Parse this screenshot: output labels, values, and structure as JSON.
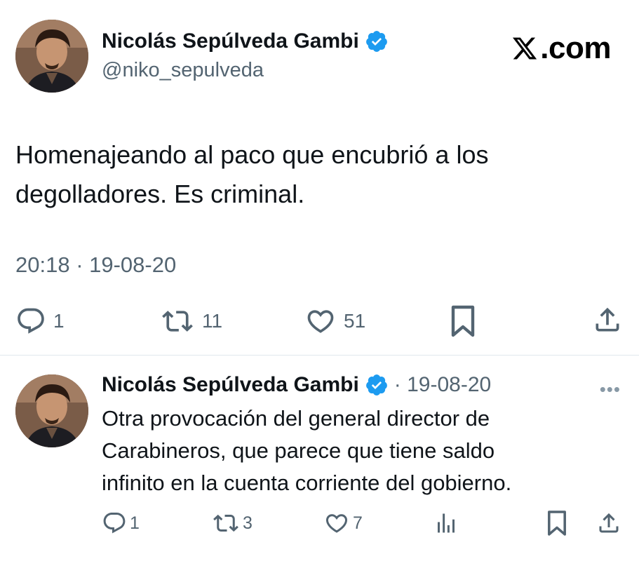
{
  "brand": {
    "text": ".com",
    "icon": "x-logo-icon"
  },
  "tweet": {
    "author_name": "Nicolás Sepúlveda Gambi",
    "handle": "@niko_sepulveda",
    "text_line1": "Homenajeando al paco que encubrió a los",
    "text_line2": "degolladores. Es criminal.",
    "timestamp": "20:18 · 19-08-20",
    "actions": {
      "reply_count": "1",
      "retweet_count": "11",
      "like_count": "51"
    }
  },
  "reply": {
    "author_name": "Nicolás Sepúlveda Gambi",
    "date": "· 19-08-20",
    "text_line1": "Otra provocación del general director de",
    "text_line2": "Carabineros, que parece que tiene saldo",
    "text_line3": "infinito en la cuenta corriente del gobierno.",
    "actions": {
      "reply_count": "1",
      "retweet_count": "3",
      "like_count": "7"
    },
    "more": "•••"
  },
  "colors": {
    "accent": "#1d9bf0",
    "muted": "#536471",
    "text": "#0f1419"
  }
}
